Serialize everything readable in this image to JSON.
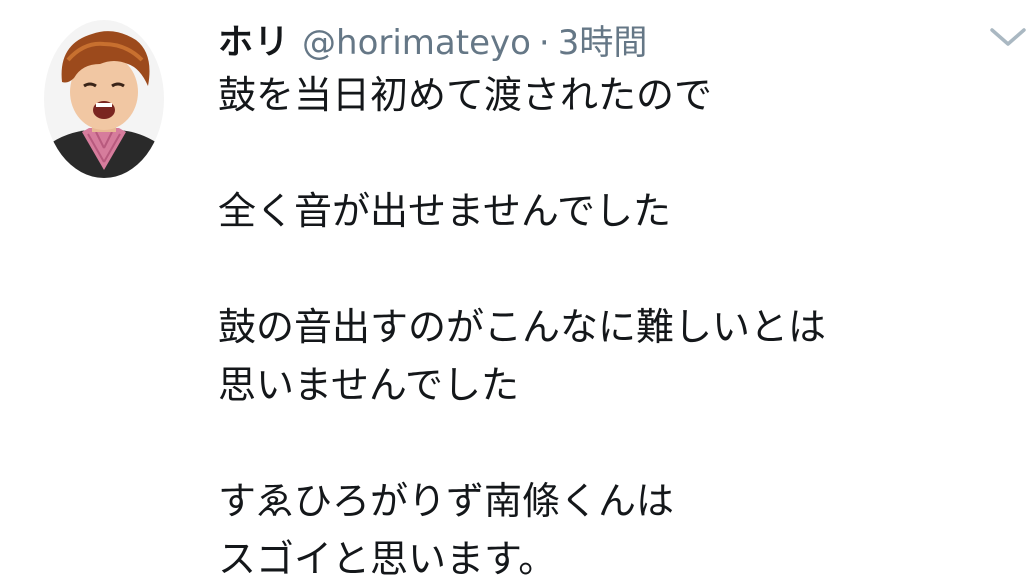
{
  "tweet": {
    "display_name": "ホリ",
    "handle": "@horimateyo",
    "separator": "·",
    "time": "3時間",
    "text": "鼓を当日初めて渡されたので\n\n全く音が出せませんでした\n\n鼓の音出すのがこんなに難しいとは\n思いませんでした\n\nすゑひろがりず南條くんは\nスゴイと思います。"
  },
  "icons": {
    "avatar": "user-avatar-photo",
    "menu": "chevron-down-icon"
  },
  "colors": {
    "text": "#14171a",
    "secondary": "#657786",
    "caret": "#aab8c2"
  }
}
